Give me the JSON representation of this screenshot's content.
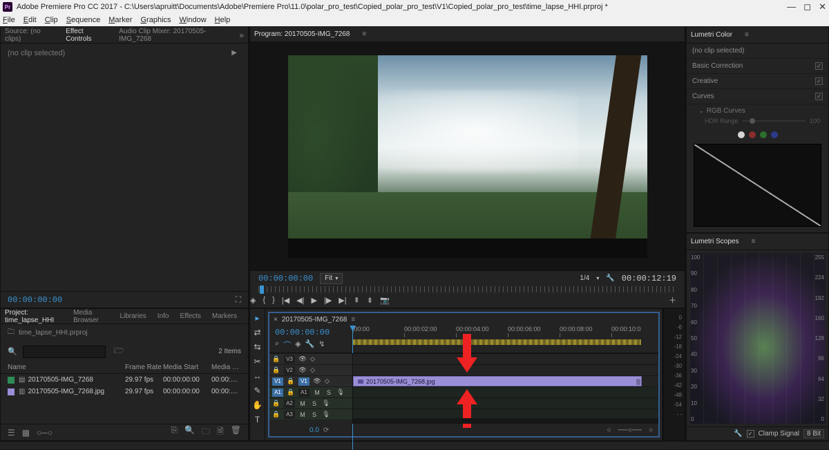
{
  "titlebar": {
    "app_badge": "Pr",
    "title": "Adobe Premiere Pro CC 2017 - C:\\Users\\apruitt\\Documents\\Adobe\\Premiere Pro\\11.0\\polar_pro_test\\Copied_polar_pro_test\\V1\\Copied_polar_pro_test\\time_lapse_HHI.prproj *"
  },
  "menu": [
    "File",
    "Edit",
    "Clip",
    "Sequence",
    "Marker",
    "Graphics",
    "Window",
    "Help"
  ],
  "source_panel": {
    "tabs": {
      "source": "Source: (no clips)",
      "effect": "Effect Controls",
      "mixer": "Audio Clip Mixer: 20170505-IMG_7268"
    },
    "no_clip_text": "(no clip selected)",
    "timecode": "00:00:00:00"
  },
  "project_panel": {
    "tabs": [
      "Project: time_lapse_HHI",
      "Media Browser",
      "Libraries",
      "Info",
      "Effects",
      "Markers"
    ],
    "project_file": "time_lapse_HHI.prproj",
    "search_placeholder": "",
    "item_count": "2 Items",
    "columns": {
      "name": "Name",
      "frame_rate": "Frame Rate",
      "media_start": "Media Start",
      "media_end": "Media …"
    },
    "rows": [
      {
        "swatch": "#2e8b57",
        "icon": "sequence",
        "name": "20170505-IMG_7268",
        "frame_rate": "29.97 fps",
        "media_start": "00:00:00:00",
        "media_end": "00:00:…"
      },
      {
        "swatch": "#9a8fd6",
        "icon": "image",
        "name": "20170505-IMG_7268.jpg",
        "frame_rate": "29.97 fps",
        "media_start": "00:00:00:00",
        "media_end": "00:00:…"
      }
    ]
  },
  "program_panel": {
    "tab": "Program: 20170505-IMG_7268",
    "timecode": "00:00:00:00",
    "zoom": "Fit",
    "scale": "1/4",
    "duration": "00:00:12:19"
  },
  "timeline": {
    "seq_tab": "20170505-IMG_7268",
    "timecode": "00:00:00:00",
    "time_marks": [
      "|00:00",
      "00:00:02:00",
      "00:00:04:00",
      "00:00:06:00",
      "00:00:08:00",
      "00:00:10:0"
    ],
    "tracks_v": [
      "V3",
      "V2",
      "V1"
    ],
    "tracks_a": [
      "A1",
      "A2",
      "A3"
    ],
    "source_v": "V1",
    "source_a": "A1",
    "clip_name": "20170505-IMG_7268.jpg",
    "audio_scale": [
      "0",
      "-6",
      "-12",
      "-18",
      "-24",
      "-30",
      "-36",
      "-42",
      "-48",
      "-54",
      "- -"
    ],
    "master_level": "0.0"
  },
  "lumetri_color": {
    "title": "Lumetri Color",
    "no_clip": "(no clip selected)",
    "sections": {
      "basic": "Basic Correction",
      "creative": "Creative",
      "curves": "Curves"
    },
    "rgb_curves": "RGB Curves",
    "hdr_label": "HDR Range",
    "hdr_value": "100"
  },
  "lumetri_scopes": {
    "title": "Lumetri Scopes",
    "left_axis": [
      "100",
      "90",
      "80",
      "70",
      "60",
      "50",
      "40",
      "30",
      "20",
      "10",
      "0"
    ],
    "right_axis": [
      "255",
      "224",
      "192",
      "160",
      "128",
      "96",
      "64",
      "32",
      "0"
    ],
    "clamp_label": "Clamp Signal",
    "bit_depth": "8 Bit"
  }
}
